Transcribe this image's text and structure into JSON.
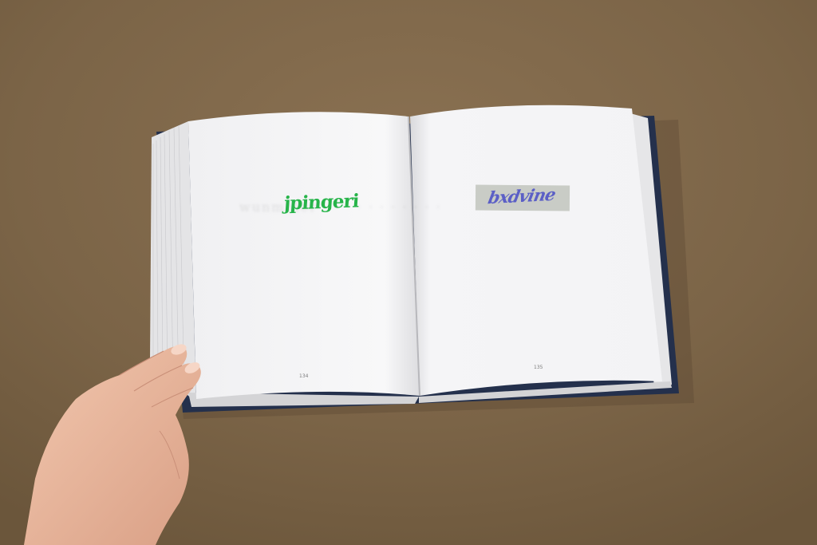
{
  "scene": {
    "description_colors": {
      "table": "#7a6446",
      "page": "#f7f7f8",
      "cover": "#24304c",
      "skin": "#e9b9a0"
    }
  },
  "book": {
    "left_page": {
      "word": "jpingeri",
      "page_number": "134"
    },
    "right_page": {
      "word": "bxdvine",
      "page_number": "135"
    }
  }
}
